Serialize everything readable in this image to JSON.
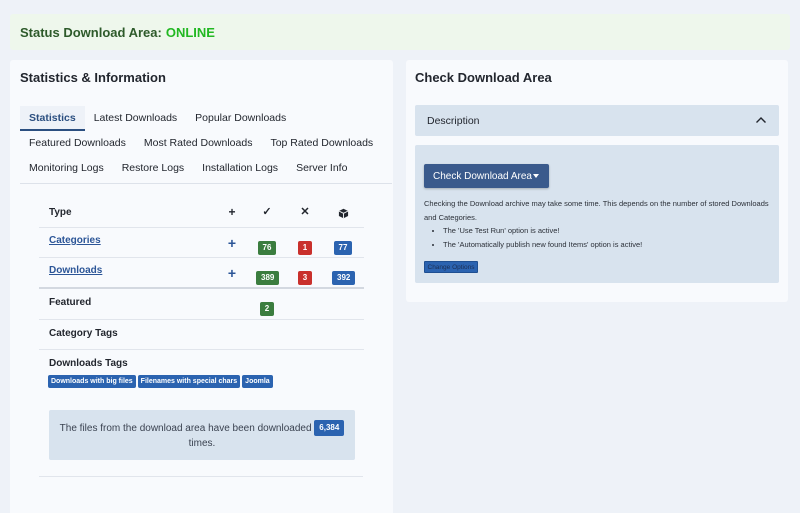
{
  "status": {
    "label": "Status Download Area:",
    "value": "ONLINE"
  },
  "left": {
    "title": "Statistics & Information",
    "tabs": [
      {
        "label": "Statistics",
        "active": true
      },
      {
        "label": "Latest Downloads"
      },
      {
        "label": "Popular Downloads"
      },
      {
        "label": "Featured Downloads"
      },
      {
        "label": "Most Rated Downloads"
      },
      {
        "label": "Top Rated Downloads"
      },
      {
        "label": "Monitoring Logs"
      },
      {
        "label": "Restore Logs"
      },
      {
        "label": "Installation Logs"
      },
      {
        "label": "Server Info"
      }
    ],
    "table": {
      "header": {
        "type": "Type",
        "icons": [
          "plus-icon",
          "check-icon",
          "x-icon",
          "box-icon"
        ]
      },
      "categories": {
        "label": "Categories",
        "published": "76",
        "unpublished": "1",
        "total": "77"
      },
      "downloads": {
        "label": "Downloads",
        "published": "389",
        "unpublished": "3",
        "total": "392"
      },
      "featured": {
        "label": "Featured",
        "count": "2"
      },
      "category_tags": {
        "label": "Category Tags"
      },
      "downloads_tags": {
        "label": "Downloads Tags",
        "tags": [
          "Downloads with big files",
          "Filenames with special chars",
          "Joomla"
        ]
      }
    },
    "counter": {
      "before": "The files from the download area have been downloaded",
      "count": "6,384",
      "after": "times."
    }
  },
  "right": {
    "title": "Check Download Area",
    "accordion_label": "Description",
    "button_label": "Check Download Area",
    "description": "Checking the Download archive may take some time. This depends on the number of stored Downloads and Categories.",
    "notes": [
      "The 'Use Test Run' option is active!",
      "The 'Automatically publish new found Items' option is active!"
    ],
    "options_button": "Change Options"
  },
  "colors": {
    "accent": "#2b4f80",
    "online": "#22b822",
    "badge_green": "#3b7d3f",
    "badge_red": "#c9302c",
    "badge_blue": "#2b63b0"
  }
}
